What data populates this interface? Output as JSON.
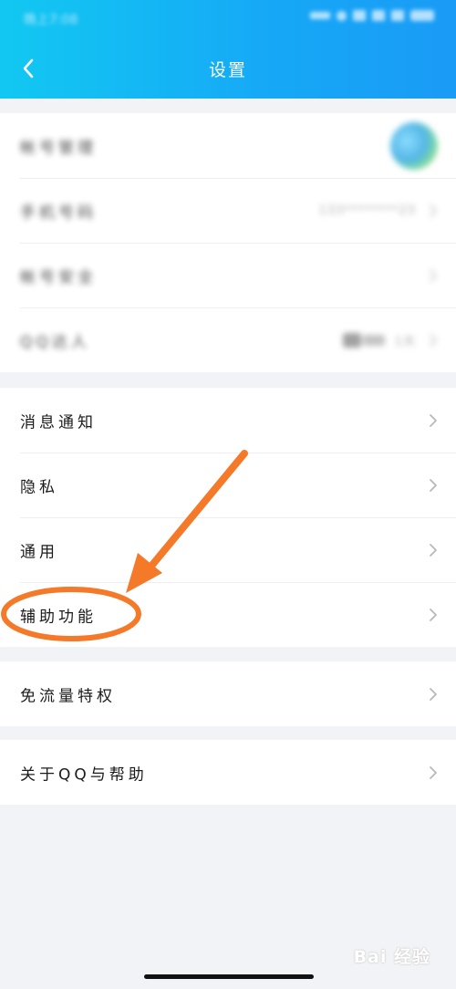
{
  "status_bar": {
    "time": "晚上7:08"
  },
  "header": {
    "title": "设置",
    "back_icon": "chevron-left-icon"
  },
  "groups": {
    "account": [
      {
        "label": "帐号管理"
      },
      {
        "label": "手机号码",
        "value": "133********23"
      },
      {
        "label": "帐号安全"
      },
      {
        "label": "QQ达人",
        "value": "1天"
      }
    ],
    "general": [
      {
        "label": "消息通知"
      },
      {
        "label": "隐私"
      },
      {
        "label": "通用"
      },
      {
        "label": "辅助功能"
      }
    ],
    "traffic": [
      {
        "label": "免流量特权"
      }
    ],
    "about": [
      {
        "label": "关于QQ与帮助"
      }
    ]
  },
  "watermark": {
    "text": "Bai 经验"
  },
  "colors": {
    "header_start": "#12c8f2",
    "header_end": "#1a9bf6",
    "annotation_orange": "#f47a2a",
    "background": "#f2f3f6"
  }
}
